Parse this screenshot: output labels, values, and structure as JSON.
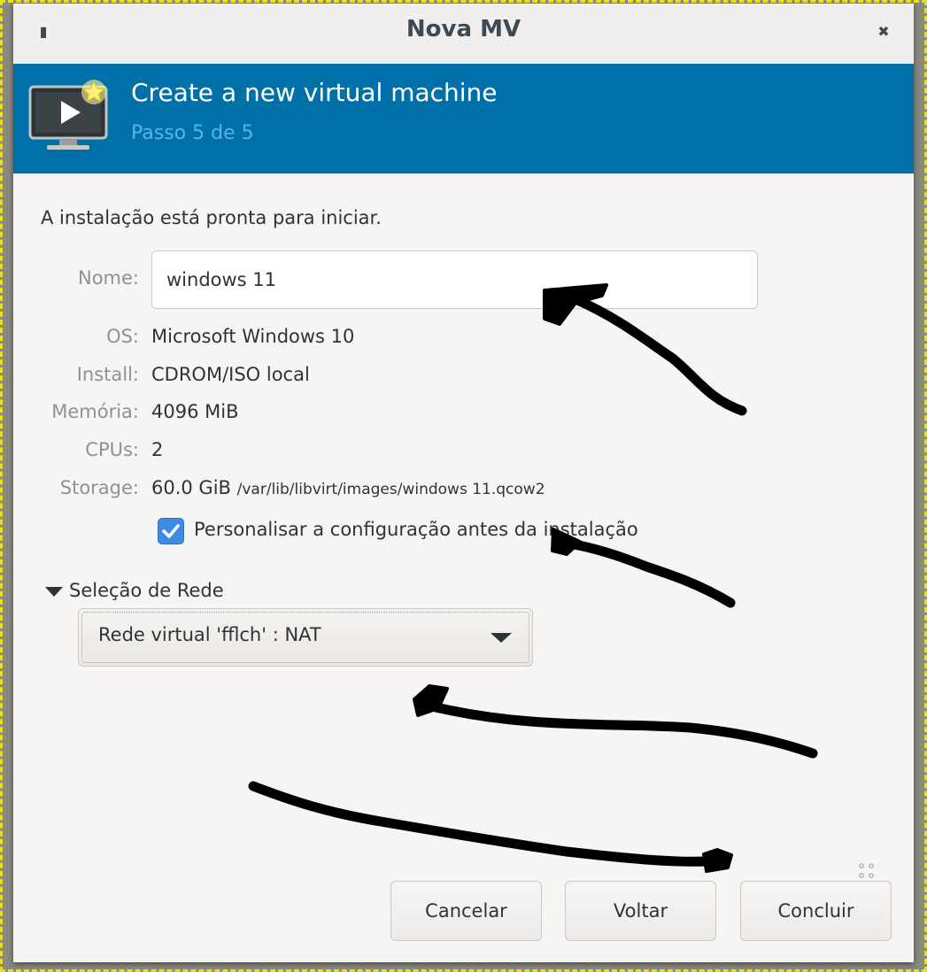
{
  "window": {
    "title": "Nova MV",
    "menu_icon": "menu-icon",
    "close_icon": "close-icon"
  },
  "banner": {
    "title": "Create a new virtual machine",
    "step": "Passo 5 de 5",
    "icon": "monitor-play-star-icon",
    "background_color": "#0070a8"
  },
  "summary": {
    "ready_text": "A instalação está pronta para iniciar.",
    "name_label": "Nome:",
    "name_value": "windows 11",
    "os_label": "OS:",
    "os_value": "Microsoft Windows 10",
    "install_label": "Install:",
    "install_value": "CDROM/ISO local",
    "memory_label": "Memória:",
    "memory_value": "4096 MiB",
    "cpus_label": "CPUs:",
    "cpus_value": "2",
    "storage_label": "Storage:",
    "storage_size": "60.0 GiB",
    "storage_path": "/var/lib/libvirt/images/windows 11.qcow2"
  },
  "customize": {
    "label": "Personalisar a configuração antes da instalação",
    "checked": true,
    "check_color": "#3f8ae2"
  },
  "network": {
    "section_label": "Seleção de Rede",
    "expanded": true,
    "selected": "Rede virtual 'fflch' : NAT"
  },
  "buttons": {
    "cancel": "Cancelar",
    "back": "Voltar",
    "finish": "Concluir"
  }
}
